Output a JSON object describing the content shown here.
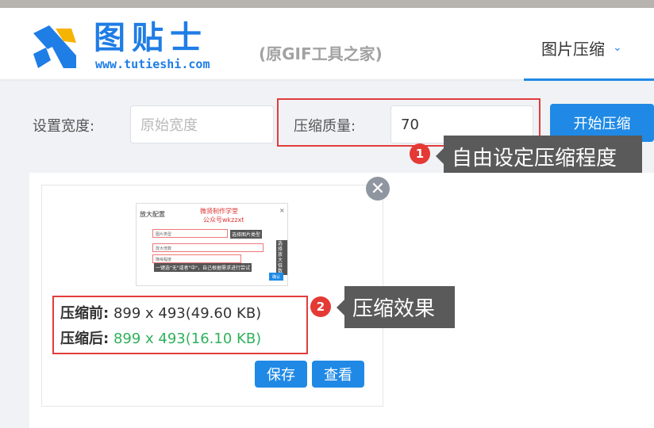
{
  "header": {
    "logo_title": "图贴士",
    "logo_url": "www.tutieshi.com",
    "logo_subtitle": "(原GIF工具之家)",
    "nav_item": "图片压缩"
  },
  "toolbar": {
    "width_label": "设置宽度:",
    "width_placeholder": "原始宽度",
    "quality_label": "压缩质量:",
    "quality_value": "70",
    "start_button": "开始压缩"
  },
  "annotations": [
    {
      "number": "1",
      "text": "自由设定压缩程度"
    },
    {
      "number": "2",
      "text": "压缩效果"
    }
  ],
  "result": {
    "close_glyph": "✕",
    "before_label": "压缩前:",
    "before_value": "899 x 493(49.60 KB)",
    "after_label": "压缩后:",
    "after_value": "899 x 493(16.10 KB)",
    "save_button": "保存",
    "view_button": "查看"
  },
  "thumbnail": {
    "title": "放大配置",
    "red_line1": "微贤制作学堂",
    "red_line2": "公众号wkzzxt",
    "close": "×",
    "tip1": "选择图片类型",
    "tip2": "选择放大倍数",
    "tip3": "一键选\"无\"或者\"中\"，自己根据需求进行尝试",
    "row1_label": "图片类型",
    "row2_label": "放大倍数",
    "row3_label": "降噪程度",
    "button": "确认"
  },
  "colors": {
    "accent": "#1f89e5",
    "logo_blue": "#1f7de6",
    "annotation_red": "#e23c3c",
    "callout_bg": "#5a5a5a",
    "after_green": "#2fb15a"
  },
  "icons": {
    "logo": "tutieshi-logo-icon",
    "nav_dropdown": "chevron-down-icon",
    "close": "close-icon"
  }
}
